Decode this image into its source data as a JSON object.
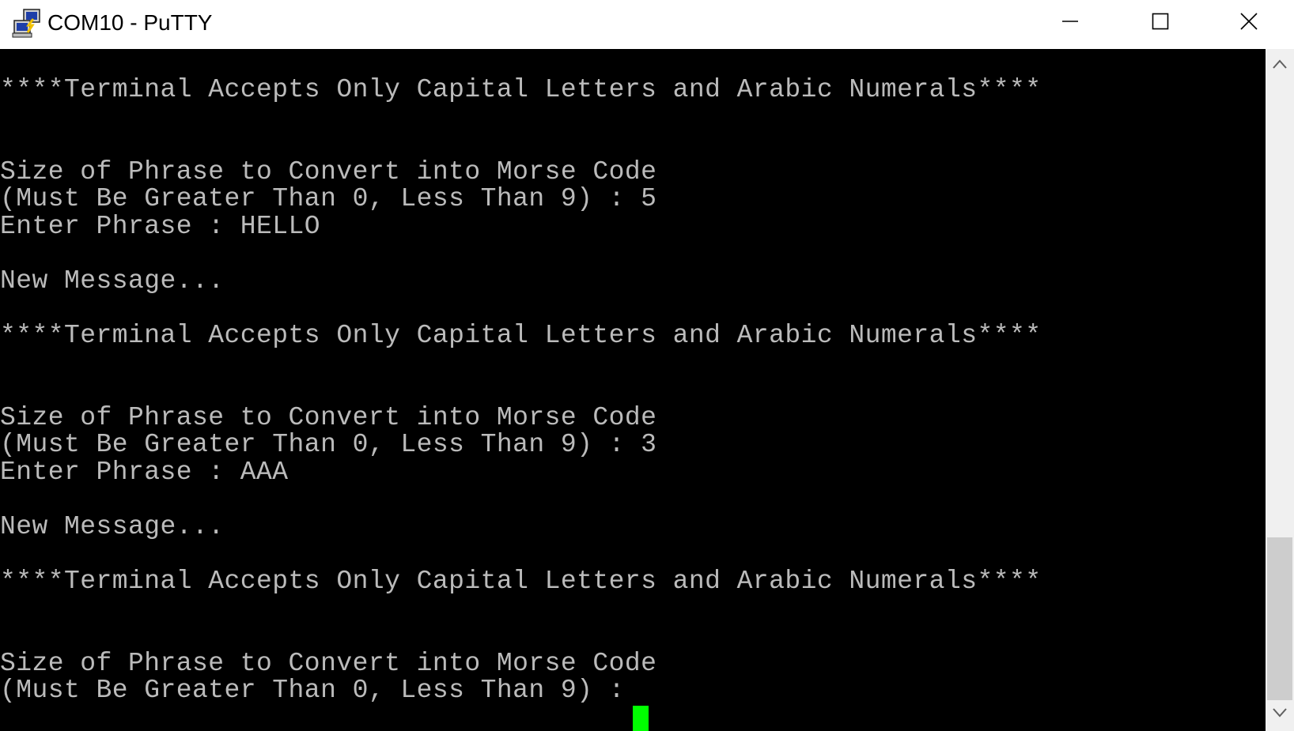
{
  "window": {
    "title": "COM10 - PuTTY",
    "icons": {
      "app": "putty-app-icon",
      "minimize": "minimize-icon",
      "maximize": "maximize-icon",
      "close": "close-icon",
      "scroll_up": "chevron-up-icon",
      "scroll_down": "chevron-down-icon"
    }
  },
  "terminal": {
    "foreground": "#bbbbbb",
    "background": "#000000",
    "cursor_color": "#00ff00",
    "lines": [
      "****Terminal Accepts Only Capital Letters and Arabic Numerals****",
      "Size of Phrase to Convert into Morse Code",
      "(Must Be Greater Than 0, Less Than 9) : 5",
      "Enter Phrase : HELLO",
      "New Message...",
      "****Terminal Accepts Only Capital Letters and Arabic Numerals****",
      "Size of Phrase to Convert into Morse Code",
      "(Must Be Greater Than 0, Less Than 9) : 3",
      "Enter Phrase : AAA",
      "New Message...",
      "****Terminal Accepts Only Capital Letters and Arabic Numerals****",
      "Size of Phrase to Convert into Morse Code",
      "(Must Be Greater Than 0, Less Than 9) : "
    ]
  }
}
